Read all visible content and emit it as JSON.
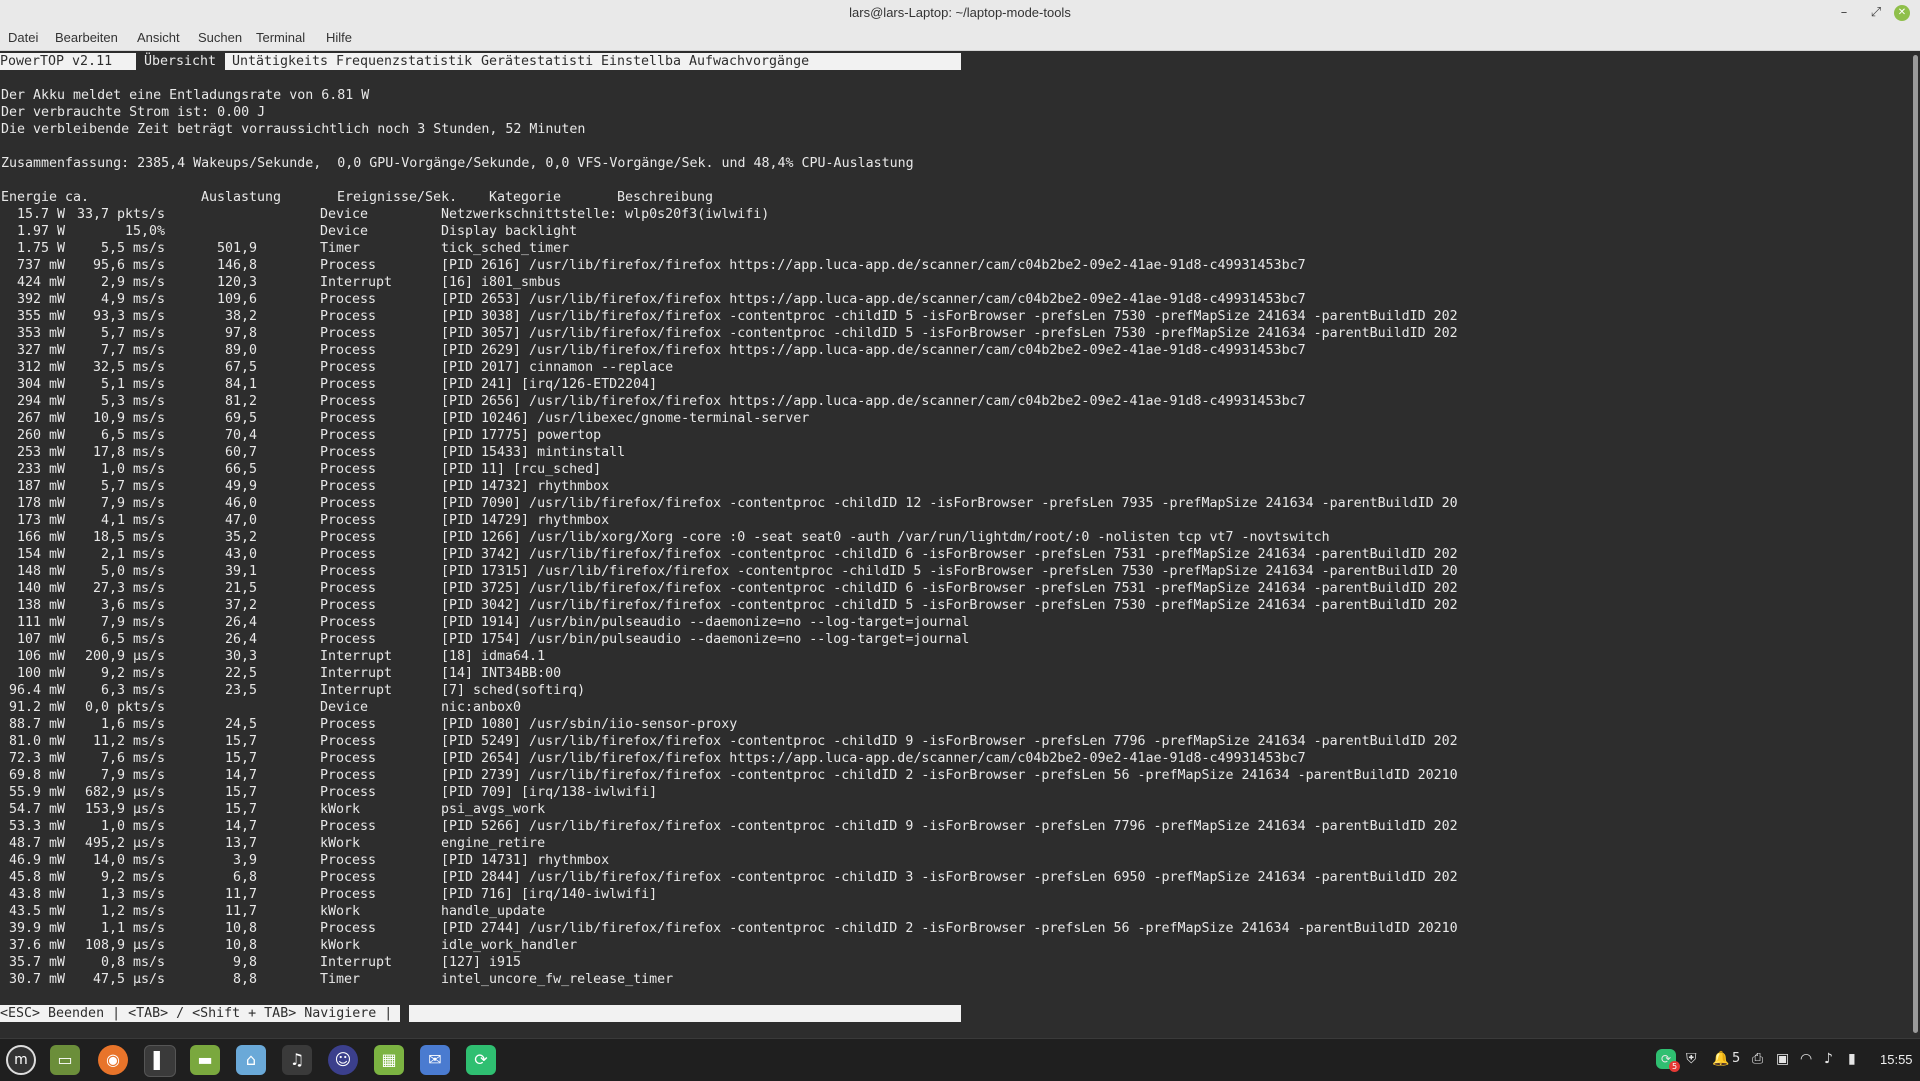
{
  "window": {
    "title": "lars@lars-Laptop: ~/laptop-mode-tools",
    "menu": [
      "Datei",
      "Bearbeiten",
      "Ansicht",
      "Suchen",
      "Terminal",
      "Hilfe"
    ]
  },
  "powertop": {
    "version_label": "PowerTOP v2.11",
    "tabs": [
      "Übersicht",
      "Untätigkeits",
      "Frequenzstatistik",
      "Gerätestatisti",
      "Einstellba",
      "Aufwachvorgänge"
    ],
    "active_tab": "Übersicht",
    "info_lines": [
      "Der Akku meldet eine Entladungsrate von 6.81 W",
      "Der verbrauchte Strom ist: 0.00 J",
      "Die verbleibende Zeit beträgt vorraussichtlich noch 3 Stunden, 52 Minuten"
    ],
    "summary": "Zusammenfassung: 2385,4 Wakeups/Sekunde,  0,0 GPU-Vorgänge/Sekunde, 0,0 VFS-Vorgänge/Sek. und 48,4% CPU-Auslastung",
    "columns": [
      "Energie ca.",
      "Auslastung",
      "Ereignisse/Sek.",
      "Kategorie",
      "Beschreibung"
    ],
    "rows": [
      [
        "15.7 W",
        "33,7 pkts/s",
        "",
        "Device",
        "Netzwerkschnittstelle: wlp0s20f3(iwlwifi)"
      ],
      [
        "1.97 W",
        "15,0%",
        "",
        "Device",
        "Display backlight"
      ],
      [
        "1.75 W",
        "5,5 ms/s",
        "501,9",
        "Timer",
        "tick_sched_timer"
      ],
      [
        "737 mW",
        "95,6 ms/s",
        "146,8",
        "Process",
        "[PID 2616] /usr/lib/firefox/firefox https://app.luca-app.de/scanner/cam/c04b2be2-09e2-41ae-91d8-c49931453bc7"
      ],
      [
        "424 mW",
        "2,9 ms/s",
        "120,3",
        "Interrupt",
        "[16] i801_smbus"
      ],
      [
        "392 mW",
        "4,9 ms/s",
        "109,6",
        "Process",
        "[PID 2653] /usr/lib/firefox/firefox https://app.luca-app.de/scanner/cam/c04b2be2-09e2-41ae-91d8-c49931453bc7"
      ],
      [
        "355 mW",
        "93,3 ms/s",
        "38,2",
        "Process",
        "[PID 3038] /usr/lib/firefox/firefox -contentproc -childID 5 -isForBrowser -prefsLen 7530 -prefMapSize 241634 -parentBuildID 202"
      ],
      [
        "353 mW",
        "5,7 ms/s",
        "97,8",
        "Process",
        "[PID 3057] /usr/lib/firefox/firefox -contentproc -childID 5 -isForBrowser -prefsLen 7530 -prefMapSize 241634 -parentBuildID 202"
      ],
      [
        "327 mW",
        "7,7 ms/s",
        "89,0",
        "Process",
        "[PID 2629] /usr/lib/firefox/firefox https://app.luca-app.de/scanner/cam/c04b2be2-09e2-41ae-91d8-c49931453bc7"
      ],
      [
        "312 mW",
        "32,5 ms/s",
        "67,5",
        "Process",
        "[PID 2017] cinnamon --replace"
      ],
      [
        "304 mW",
        "5,1 ms/s",
        "84,1",
        "Process",
        "[PID 241] [irq/126-ETD2204]"
      ],
      [
        "294 mW",
        "5,3 ms/s",
        "81,2",
        "Process",
        "[PID 2656] /usr/lib/firefox/firefox https://app.luca-app.de/scanner/cam/c04b2be2-09e2-41ae-91d8-c49931453bc7"
      ],
      [
        "267 mW",
        "10,9 ms/s",
        "69,5",
        "Process",
        "[PID 10246] /usr/libexec/gnome-terminal-server"
      ],
      [
        "260 mW",
        "6,5 ms/s",
        "70,4",
        "Process",
        "[PID 17775] powertop"
      ],
      [
        "253 mW",
        "17,8 ms/s",
        "60,7",
        "Process",
        "[PID 15433] mintinstall"
      ],
      [
        "233 mW",
        "1,0 ms/s",
        "66,5",
        "Process",
        "[PID 11] [rcu_sched]"
      ],
      [
        "187 mW",
        "5,7 ms/s",
        "49,9",
        "Process",
        "[PID 14732] rhythmbox"
      ],
      [
        "178 mW",
        "7,9 ms/s",
        "46,0",
        "Process",
        "[PID 7090] /usr/lib/firefox/firefox -contentproc -childID 12 -isForBrowser -prefsLen 7935 -prefMapSize 241634 -parentBuildID 20"
      ],
      [
        "173 mW",
        "4,1 ms/s",
        "47,0",
        "Process",
        "[PID 14729] rhythmbox"
      ],
      [
        "166 mW",
        "18,5 ms/s",
        "35,2",
        "Process",
        "[PID 1266] /usr/lib/xorg/Xorg -core :0 -seat seat0 -auth /var/run/lightdm/root/:0 -nolisten tcp vt7 -novtswitch"
      ],
      [
        "154 mW",
        "2,1 ms/s",
        "43,0",
        "Process",
        "[PID 3742] /usr/lib/firefox/firefox -contentproc -childID 6 -isForBrowser -prefsLen 7531 -prefMapSize 241634 -parentBuildID 202"
      ],
      [
        "148 mW",
        "5,0 ms/s",
        "39,1",
        "Process",
        "[PID 17315] /usr/lib/firefox/firefox -contentproc -childID 5 -isForBrowser -prefsLen 7530 -prefMapSize 241634 -parentBuildID 20"
      ],
      [
        "140 mW",
        "27,3 ms/s",
        "21,5",
        "Process",
        "[PID 3725] /usr/lib/firefox/firefox -contentproc -childID 6 -isForBrowser -prefsLen 7531 -prefMapSize 241634 -parentBuildID 202"
      ],
      [
        "138 mW",
        "3,6 ms/s",
        "37,2",
        "Process",
        "[PID 3042] /usr/lib/firefox/firefox -contentproc -childID 5 -isForBrowser -prefsLen 7530 -prefMapSize 241634 -parentBuildID 202"
      ],
      [
        "111 mW",
        "7,9 ms/s",
        "26,4",
        "Process",
        "[PID 1914] /usr/bin/pulseaudio --daemonize=no --log-target=journal"
      ],
      [
        "107 mW",
        "6,5 ms/s",
        "26,4",
        "Process",
        "[PID 1754] /usr/bin/pulseaudio --daemonize=no --log-target=journal"
      ],
      [
        "106 mW",
        "200,9 µs/s",
        "30,3",
        "Interrupt",
        "[18] idma64.1"
      ],
      [
        "100 mW",
        "9,2 ms/s",
        "22,5",
        "Interrupt",
        "[14] INT34BB:00"
      ],
      [
        "96.4 mW",
        "6,3 ms/s",
        "23,5",
        "Interrupt",
        "[7] sched(softirq)"
      ],
      [
        "91.2 mW",
        "0,0 pkts/s",
        "",
        "Device",
        "nic:anbox0"
      ],
      [
        "88.7 mW",
        "1,6 ms/s",
        "24,5",
        "Process",
        "[PID 1080] /usr/sbin/iio-sensor-proxy"
      ],
      [
        "81.0 mW",
        "11,2 ms/s",
        "15,7",
        "Process",
        "[PID 5249] /usr/lib/firefox/firefox -contentproc -childID 9 -isForBrowser -prefsLen 7796 -prefMapSize 241634 -parentBuildID 202"
      ],
      [
        "72.3 mW",
        "7,6 ms/s",
        "15,7",
        "Process",
        "[PID 2654] /usr/lib/firefox/firefox https://app.luca-app.de/scanner/cam/c04b2be2-09e2-41ae-91d8-c49931453bc7"
      ],
      [
        "69.8 mW",
        "7,9 ms/s",
        "14,7",
        "Process",
        "[PID 2739] /usr/lib/firefox/firefox -contentproc -childID 2 -isForBrowser -prefsLen 56 -prefMapSize 241634 -parentBuildID 20210"
      ],
      [
        "55.9 mW",
        "682,9 µs/s",
        "15,7",
        "Process",
        "[PID 709] [irq/138-iwlwifi]"
      ],
      [
        "54.7 mW",
        "153,9 µs/s",
        "15,7",
        "kWork",
        "psi_avgs_work"
      ],
      [
        "53.3 mW",
        "1,0 ms/s",
        "14,7",
        "Process",
        "[PID 5266] /usr/lib/firefox/firefox -contentproc -childID 9 -isForBrowser -prefsLen 7796 -prefMapSize 241634 -parentBuildID 202"
      ],
      [
        "48.7 mW",
        "495,2 µs/s",
        "13,7",
        "kWork",
        "engine_retire"
      ],
      [
        "46.9 mW",
        "14,0 ms/s",
        "3,9",
        "Process",
        "[PID 14731] rhythmbox"
      ],
      [
        "45.8 mW",
        "9,2 ms/s",
        "6,8",
        "Process",
        "[PID 2844] /usr/lib/firefox/firefox -contentproc -childID 3 -isForBrowser -prefsLen 6950 -prefMapSize 241634 -parentBuildID 202"
      ],
      [
        "43.8 mW",
        "1,3 ms/s",
        "11,7",
        "Process",
        "[PID 716] [irq/140-iwlwifi]"
      ],
      [
        "43.5 mW",
        "1,2 ms/s",
        "11,7",
        "kWork",
        "handle_update"
      ],
      [
        "39.9 mW",
        "1,1 ms/s",
        "10,8",
        "Process",
        "[PID 2744] /usr/lib/firefox/firefox -contentproc -childID 2 -isForBrowser -prefsLen 56 -prefMapSize 241634 -parentBuildID 20210"
      ],
      [
        "37.6 mW",
        "108,9 µs/s",
        "10,8",
        "kWork",
        "idle_work_handler"
      ],
      [
        "35.7 mW",
        "0,8 ms/s",
        "9,8",
        "Interrupt",
        "[127] i915"
      ],
      [
        "30.7 mW",
        "47,5 µs/s",
        "8,8",
        "Timer",
        "intel_uncore_fw_release_timer"
      ]
    ],
    "footer": "<ESC> Beenden | <TAB> / <Shift + TAB> Navigiere |"
  },
  "taskbar": {
    "apps": [
      "menu-icon",
      "show-desktop-icon",
      "firefox-icon",
      "terminal-icon",
      "files-icon",
      "software-icon",
      "rhythmbox-icon",
      "discord-icon",
      "calculator-icon",
      "mail-icon",
      "update-icon"
    ],
    "tray_badge": "5",
    "notification_count": "5",
    "clock": "15:55"
  }
}
